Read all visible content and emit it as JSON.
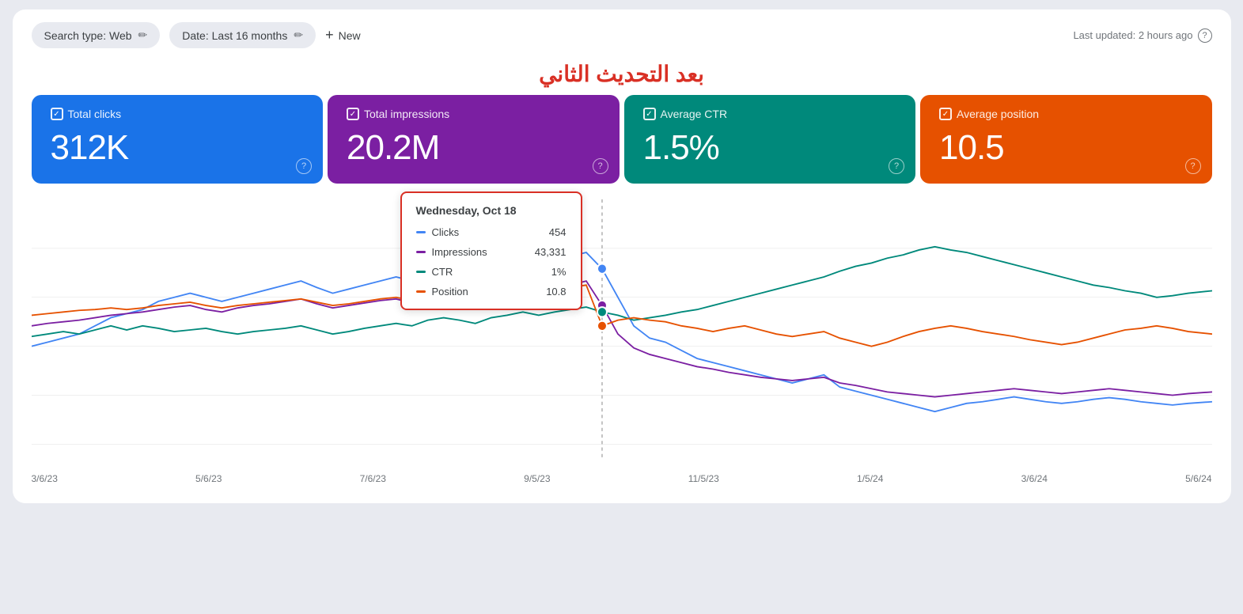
{
  "topbar": {
    "search_type_label": "Search type: Web",
    "search_type_edit_icon": "✏",
    "date_label": "Date: Last 16 months",
    "date_edit_icon": "✏",
    "new_plus": "+",
    "new_label": "New",
    "last_updated": "Last updated: 2 hours ago",
    "help_icon": "?"
  },
  "arabic_title": "بعد التحديث الثاني",
  "metrics": [
    {
      "id": "total-clicks",
      "label": "Total clicks",
      "value": "312K",
      "color": "blue"
    },
    {
      "id": "total-impressions",
      "label": "Total impressions",
      "value": "20.2M",
      "color": "purple"
    },
    {
      "id": "average-ctr",
      "label": "Average CTR",
      "value": "1.5%",
      "color": "teal"
    },
    {
      "id": "average-position",
      "label": "Average position",
      "value": "10.5",
      "color": "orange"
    }
  ],
  "tooltip": {
    "date": "Wednesday, Oct 18",
    "rows": [
      {
        "label": "Clicks",
        "value": "454",
        "color": "#4285f4",
        "type": "line"
      },
      {
        "label": "Impressions",
        "value": "43,331",
        "color": "#7b1fa2",
        "type": "line"
      },
      {
        "label": "CTR",
        "value": "1%",
        "color": "#00897b",
        "type": "line"
      },
      {
        "label": "Position",
        "value": "10.8",
        "color": "#e65100",
        "type": "dash"
      }
    ]
  },
  "x_axis_labels": [
    "3/6/23",
    "5/6/23",
    "7/6/23",
    "9/5/23",
    "11/5/23",
    "1/5/24",
    "3/6/24",
    "5/6/24"
  ]
}
